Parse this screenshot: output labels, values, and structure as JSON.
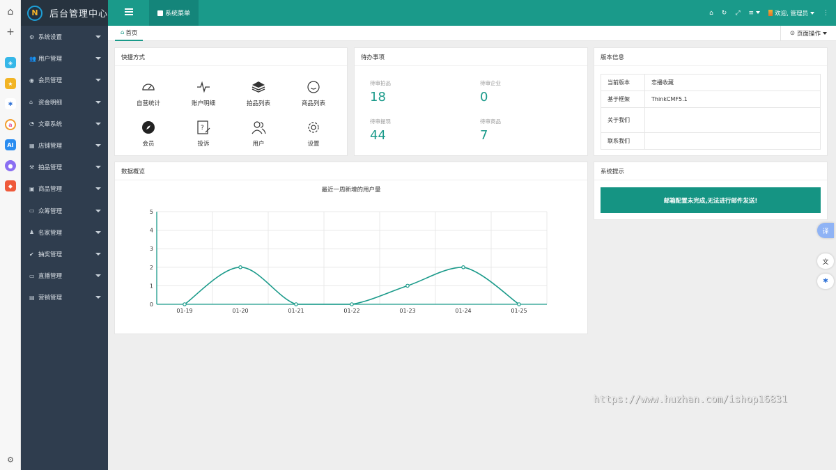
{
  "brand": {
    "title": "后台管理中心",
    "logo_letter": "N"
  },
  "sidebar": {
    "items": [
      {
        "label": "系统设置",
        "icon": "gears-icon"
      },
      {
        "label": "用户管理",
        "icon": "users-icon"
      },
      {
        "label": "会员管理",
        "icon": "user-circle-icon"
      },
      {
        "label": "资金明细",
        "icon": "bank-icon"
      },
      {
        "label": "文章系统",
        "icon": "pie-chart-icon"
      },
      {
        "label": "店铺管理",
        "icon": "grid-icon"
      },
      {
        "label": "拍品管理",
        "icon": "gavel-icon"
      },
      {
        "label": "商品管理",
        "icon": "shop-icon"
      },
      {
        "label": "众筹管理",
        "icon": "money-icon"
      },
      {
        "label": "名家管理",
        "icon": "person-icon"
      },
      {
        "label": "抽奖管理",
        "icon": "check-circle-icon"
      },
      {
        "label": "直播管理",
        "icon": "monitor-icon"
      },
      {
        "label": "营销管理",
        "icon": "briefcase-icon"
      }
    ]
  },
  "topbar": {
    "tab_label": "系统菜单",
    "welcome": "欢迎, 管理员"
  },
  "tabbar": {
    "home_label": "首页",
    "page_ops": "页面操作"
  },
  "shortcuts": {
    "title": "快捷方式",
    "items": [
      {
        "label": "自营统计",
        "icon": "dashboard-icon"
      },
      {
        "label": "账户明细",
        "icon": "pulse-icon"
      },
      {
        "label": "拍品列表",
        "icon": "layers-icon"
      },
      {
        "label": "商品列表",
        "icon": "smile-icon"
      },
      {
        "label": "会员",
        "icon": "compass-icon"
      },
      {
        "label": "投诉",
        "icon": "help-doc-icon"
      },
      {
        "label": "用户",
        "icon": "users-icon"
      },
      {
        "label": "设置",
        "icon": "gear-icon"
      }
    ]
  },
  "todo": {
    "title": "待办事项",
    "items": [
      {
        "label": "待审拍品",
        "value": "18"
      },
      {
        "label": "待审企业",
        "value": "0"
      },
      {
        "label": "待审提现",
        "value": "44"
      },
      {
        "label": "待审商品",
        "value": "7"
      }
    ]
  },
  "version": {
    "title": "版本信息",
    "rows": [
      {
        "key": "当前版本",
        "value": "恋播收藏"
      },
      {
        "key": "基于框架",
        "value": "ThinkCMF5.1"
      },
      {
        "key": "关于我们",
        "value": ""
      },
      {
        "key": "联系我们",
        "value": ""
      }
    ]
  },
  "overview": {
    "title": "数据概览"
  },
  "tips": {
    "title": "系统提示",
    "message": "邮箱配置未完成,无法进行邮件发送!"
  },
  "floaters": {
    "translate": "译"
  },
  "watermark": "https://www.huzhan.com/ishop16831",
  "colors": {
    "primary": "#1a9a8a",
    "sidebar": "#2f3d4e",
    "line": "#1a9a8a"
  },
  "chart_data": {
    "type": "line",
    "title": "最近一周新增的用户量",
    "categories": [
      "01-19",
      "01-20",
      "01-21",
      "01-22",
      "01-23",
      "01-24",
      "01-25"
    ],
    "values": [
      0,
      2,
      0,
      0,
      1,
      2,
      0
    ],
    "ylim": [
      0,
      5
    ],
    "yticks": [
      0,
      1,
      2,
      3,
      4,
      5
    ],
    "grid": true,
    "smooth": true
  }
}
